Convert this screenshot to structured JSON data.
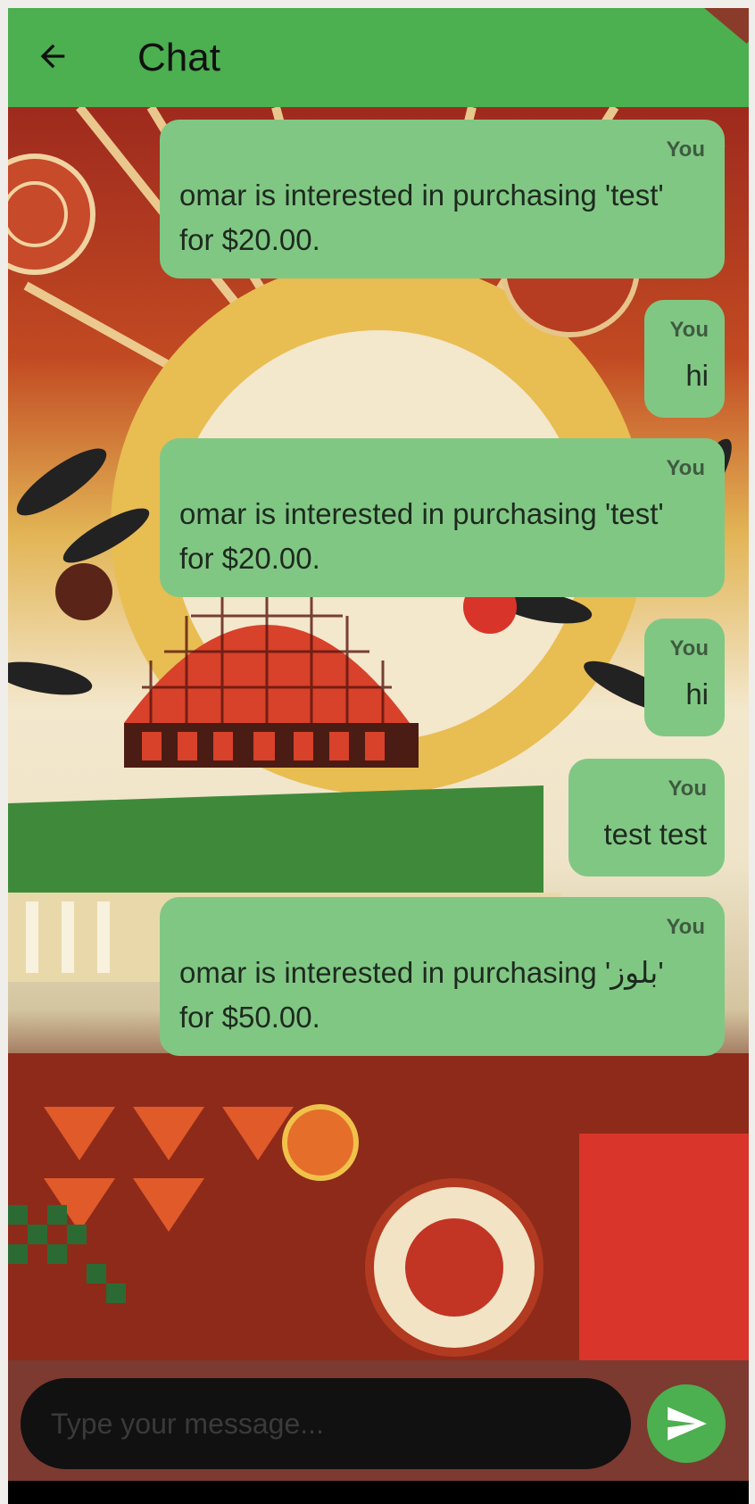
{
  "header": {
    "title": "Chat",
    "back_icon": "arrow-left-icon"
  },
  "colors": {
    "appbar": "#4caf50",
    "bubble": "#81c784",
    "send_button": "#4caf50"
  },
  "messages": [
    {
      "sender": "You",
      "text": "omar is interested in purchasing 'test' for $20.00."
    },
    {
      "sender": "You",
      "text": "hi"
    },
    {
      "sender": "You",
      "text": "omar is interested in purchasing 'test' for $20.00."
    },
    {
      "sender": "You",
      "text": "hi"
    },
    {
      "sender": "You",
      "text": "test test"
    },
    {
      "sender": "You",
      "text": "omar is interested in purchasing 'بلوز' for $50.00."
    }
  ],
  "composer": {
    "placeholder": "Type your message...",
    "send_icon": "send-icon"
  }
}
